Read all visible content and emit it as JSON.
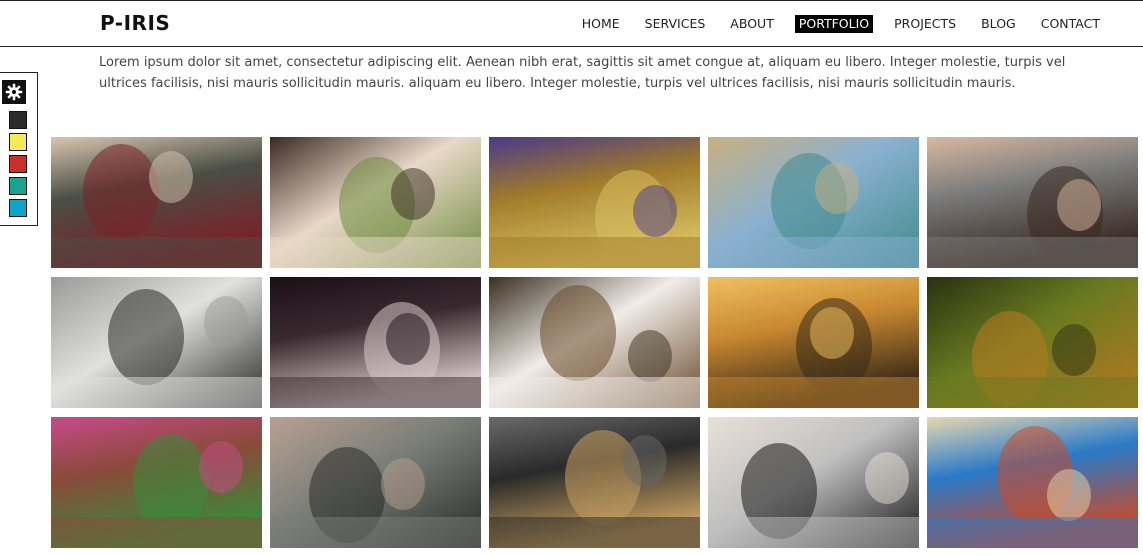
{
  "header": {
    "logo": "P-IRIS",
    "nav": [
      "HOME",
      "SERVICES",
      "ABOUT",
      "PORTFOLIO",
      "PROJECTS",
      "BLOG",
      "CONTACT"
    ],
    "active_nav": "PORTFOLIO"
  },
  "intro": {
    "text": "Lorem ipsum dolor sit amet, consectetur adipiscing elit. Aenean nibh erat, sagittis sit amet congue at, aliquam eu libero. Integer molestie, turpis vel ultrices facilisis, nisi mauris sollicitudin mauris. aliquam eu libero. Integer molestie, turpis vel ultrices facilisis, nisi mauris sollicitudin mauris."
  },
  "style_switcher": {
    "icon": "gear-icon",
    "swatches": [
      "#2b2b2b",
      "#f4ea55",
      "#c9302c",
      "#1aa394",
      "#0ea3c7"
    ]
  },
  "gallery": {
    "items": [
      {
        "subject": "woman-red-coat-dandelion",
        "palette": [
          "#4a4f45",
          "#7b2028",
          "#d9c6b0"
        ]
      },
      {
        "subject": "woman-lying-grass",
        "palette": [
          "#e8d8c8",
          "#6e8a3c",
          "#3a2a22"
        ]
      },
      {
        "subject": "women-sitting-street",
        "palette": [
          "#a07a2a",
          "#d8c060",
          "#4a3a8a"
        ]
      },
      {
        "subject": "city-bridge-crowd",
        "palette": [
          "#8ab0d0",
          "#3f8a8a",
          "#c8b080"
        ]
      },
      {
        "subject": "woman-portrait-grey",
        "palette": [
          "#7a7a7a",
          "#3a2a22",
          "#d8b8a0"
        ]
      },
      {
        "subject": "girl-dark-hair-sunlight",
        "palette": [
          "#e0e0dc",
          "#2a2a2a",
          "#9a9a98"
        ]
      },
      {
        "subject": "woman-lying-bw",
        "palette": [
          "#3a2a30",
          "#d8c8c8",
          "#1a1016"
        ]
      },
      {
        "subject": "woman-grey-hat",
        "palette": [
          "#f0ece8",
          "#6a4a2a",
          "#3a3020"
        ]
      },
      {
        "subject": "sunset-street-lamps",
        "palette": [
          "#c88830",
          "#3a2a18",
          "#f0c060"
        ]
      },
      {
        "subject": "tree-lined-avenue",
        "palette": [
          "#6a7a20",
          "#b87a20",
          "#2a3010"
        ]
      },
      {
        "subject": "graffiti-market",
        "palette": [
          "#8a4a3a",
          "#3a8a3a",
          "#c84a8a"
        ]
      },
      {
        "subject": "woman-grey-hoodie",
        "palette": [
          "#7a7e78",
          "#2a2a28",
          "#b8a090"
        ]
      },
      {
        "subject": "night-street-shopping",
        "palette": [
          "#2a2a2a",
          "#c8a060",
          "#6a6a6a"
        ]
      },
      {
        "subject": "asian-woman-portrait-bw",
        "palette": [
          "#c0c0c0",
          "#1a1a1a",
          "#e8e0d8"
        ]
      },
      {
        "subject": "amusement-park-rides",
        "palette": [
          "#2a7ac8",
          "#c84a2a",
          "#e8d8b0"
        ]
      }
    ]
  }
}
